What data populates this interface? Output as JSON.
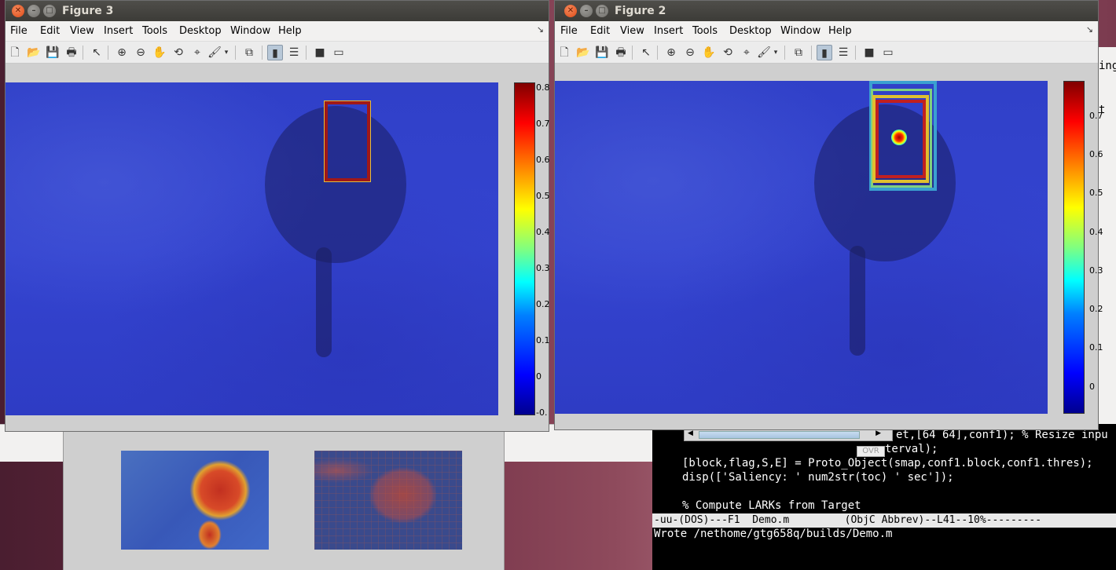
{
  "figure3": {
    "title": "Figure 3",
    "menu": [
      "File",
      "Edit",
      "View",
      "Insert",
      "Tools",
      "Desktop",
      "Window",
      "Help"
    ],
    "colorbar_ticks": [
      "0.8",
      "0.7",
      "0.6",
      "0.5",
      "0.4",
      "0.3",
      "0.2",
      "0.1",
      "0",
      "-0."
    ]
  },
  "figure2": {
    "title": "Figure 2",
    "menu": [
      "File",
      "Edit",
      "View",
      "Insert",
      "Tools",
      "Desktop",
      "Window",
      "Help"
    ],
    "colorbar_ticks": [
      "0.7",
      "0.6",
      "0.5",
      "0.4",
      "0.3",
      "0.2",
      "0.1",
      "0"
    ]
  },
  "toolbar_icons": [
    "new-file-icon",
    "open-folder-icon",
    "save-icon",
    "print-icon",
    "pointer-icon",
    "zoom-in-icon",
    "zoom-out-icon",
    "pan-hand-icon",
    "rotate-3d-icon",
    "data-cursor-icon",
    "brush-icon",
    "brush-dropdown-icon",
    "link-plot-icon",
    "colorbar-icon",
    "legend-icon",
    "hide-plot-tools-icon",
    "show-plot-tools-icon"
  ],
  "emacs": {
    "lines": [
      "et,[64 64],conf1); % Resize inpu",
      "terval);",
      "[block,flag,S,E] = Proto_Object(smap,conf1.block,conf1.thres);",
      "disp(['Saliency: ' num2str(toc) ' sec']);",
      "",
      "% Compute LARKs from Target"
    ],
    "modeline": "-uu-(DOS)---F1  Demo.m         (ObjC Abbrev)--L41--10%---------",
    "modeline_file": "Demo.m",
    "minibuffer": "Wrote /nethome/gtg658q/builds/Demo.m",
    "ovr": "OVR"
  },
  "right_edge_text": [
    "ing",
    "",
    "t"
  ]
}
